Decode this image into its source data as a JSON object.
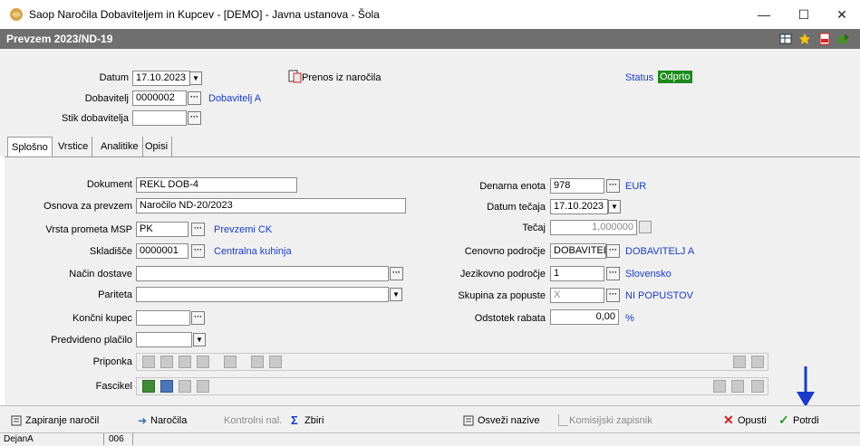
{
  "window": {
    "title": "Saop  Naročila Dobaviteljem in Kupcev - [DEMO] - Javna ustanova - Šola",
    "minimize": "—",
    "maximize": "☐",
    "close": "✕"
  },
  "header": {
    "title": "Prevzem 2023/ND-19"
  },
  "top": {
    "datum_label": "Datum",
    "datum_value": "17.10.2023",
    "dobavitelj_label": "Dobavitelj",
    "dobavitelj_value": "0000002",
    "dobavitelj_name": "Dobavitelj A",
    "stik_label": "Stik dobavitelja",
    "stik_value": "",
    "prenos_label": "Prenos iz naročila",
    "status_label": "Status",
    "status_value": "Odprto"
  },
  "tabs": [
    "Splošno",
    "Vrstice",
    "Analitike",
    "Opisi"
  ],
  "left": {
    "dokument_label": "Dokument",
    "dokument_value": "REKL DOB-4",
    "osnova_label": "Osnova za prevzem",
    "osnova_value": "Naročilo ND-20/2023",
    "vrsta_label": "Vrsta prometa MSP",
    "vrsta_value": "PK",
    "vrsta_name": "Prevzemi CK",
    "skladisce_label": "Skladišče",
    "skladisce_value": "0000001",
    "skladisce_name": "Centralna kuhinja",
    "nacin_label": "Način dostave",
    "nacin_value": "",
    "pariteta_label": "Pariteta",
    "pariteta_value": "",
    "koncni_label": "Končni kupec",
    "koncni_value": "",
    "predvideno_label": "Predvideno plačilo",
    "predvideno_value": "",
    "priponka_label": "Priponka",
    "fascikel_label": "Fascikel"
  },
  "right": {
    "denarna_label": "Denarna enota",
    "denarna_value": "978",
    "denarna_name": "EUR",
    "datum_tecaja_label": "Datum tečaja",
    "datum_tecaja_value": "17.10.2023",
    "tecaj_label": "Tečaj",
    "tecaj_value": "1,000000",
    "cenovno_label": "Cenovno področje",
    "cenovno_value": "DOBAVITELJ",
    "cenovno_name": "DOBAVITELJ A",
    "jezikovno_label": "Jezikovno področje",
    "jezikovno_value": "1",
    "jezikovno_name": "Slovensko",
    "skupina_label": "Skupina za popuste",
    "skupina_value": "X",
    "skupina_name": "NI POPUSTOV",
    "odstotek_label": "Odstotek rabata",
    "odstotek_value": "0,00",
    "odstotek_unit": "%"
  },
  "bottom": {
    "zapiranje": "Zapiranje naročil",
    "narocila": "Naročila",
    "kontrolni": "Kontrolni nal.",
    "zbiri": "Zbiri",
    "osvezi": "Osveži nazive",
    "komisijski": "Komisijski zapisnik",
    "opusti": "Opusti",
    "potrdi": "Potrdi"
  },
  "status": {
    "user": "DejanA",
    "code": "006"
  },
  "colors": {
    "header_bg": "#6f6f6f",
    "link": "#1a3cc8",
    "status_bg": "#1e8a1e",
    "arrow": "#1a3cc8"
  }
}
